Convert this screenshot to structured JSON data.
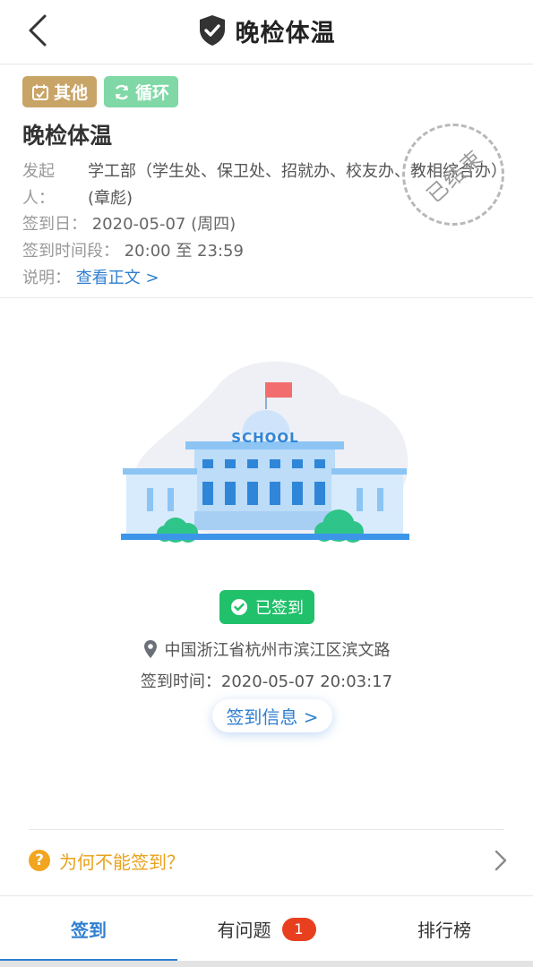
{
  "header": {
    "title": "晚检体温",
    "back_icon": "chevron-left-icon",
    "title_icon": "shield-check-icon"
  },
  "task": {
    "tags": [
      {
        "label": "其他",
        "icon": "calendar-icon",
        "color": "#c9a467"
      },
      {
        "label": "循环",
        "icon": "refresh-icon",
        "color": "#7fd8a6"
      }
    ],
    "title": "晚检体温",
    "initiator_label": "发起人：",
    "initiator_value": "学工部（学生处、保卫处、招就办、校友办、教相综合办）(章彪)",
    "date_label": "签到日：",
    "date_value": "2020-05-07 (周四)",
    "time_label": "签到时间段：",
    "time_value": "20:00 至 23:59",
    "desc_label": "说明：",
    "desc_link": "查看正文 >",
    "stamp": "已结束"
  },
  "illustration": {
    "sign": "SCHOOL",
    "icon": "school-building-icon"
  },
  "status": {
    "badge": "已签到",
    "badge_color": "#21c16b",
    "location": "中国浙江省杭州市滨江区滨文路",
    "time": "签到时间：2020-05-07 20:03:17",
    "info_button": "签到信息 >"
  },
  "help": {
    "text": "为何不能签到？",
    "icon": "question-circle-icon"
  },
  "tabs": [
    {
      "label": "签到",
      "active": true
    },
    {
      "label": "有问题",
      "badge": "1"
    },
    {
      "label": "排行榜"
    }
  ],
  "colors": {
    "accent": "#2f7fd0",
    "warning": "#e9a21c",
    "badge_red": "#e8401f"
  }
}
